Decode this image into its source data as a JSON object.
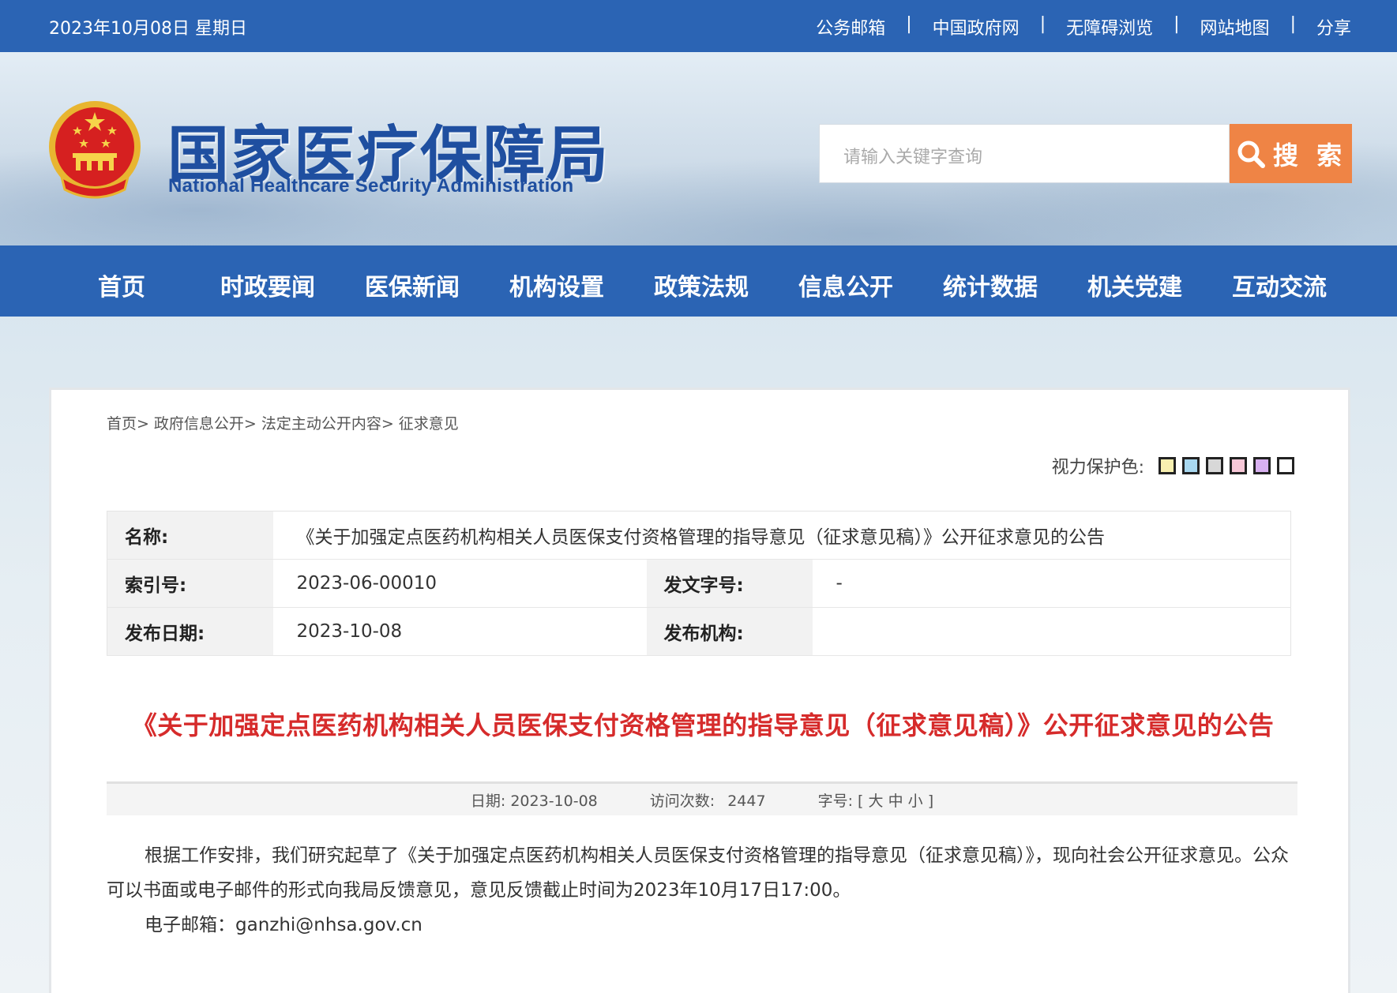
{
  "topbar": {
    "date": "2023年10月08日 星期日",
    "links": [
      "公务邮箱",
      "中国政府网",
      "无障碍浏览",
      "网站地图",
      "分享"
    ],
    "separator": "|"
  },
  "header": {
    "emblem_icon": "national-emblem-icon",
    "logo_cn": "国家医疗保障局",
    "logo_en": "National Healthcare Security Administration",
    "search_placeholder": "请输入关键字查询",
    "search_button": "搜 索"
  },
  "nav": {
    "items": [
      "首页",
      "时政要闻",
      "医保新闻",
      "机构设置",
      "政策法规",
      "信息公开",
      "统计数据",
      "机关党建",
      "互动交流"
    ]
  },
  "breadcrumb": [
    "首页>",
    "政府信息公开>",
    "法定主动公开内容>",
    "征求意见"
  ],
  "vision": {
    "label": "视力保护色:",
    "swatches": [
      "#f8f0b0",
      "#a8d8f0",
      "#d8d8d8",
      "#f8c8d8",
      "#d8b0f0",
      "#ffffff"
    ]
  },
  "info_table": {
    "name_label": "名称:",
    "name_value": "《关于加强定点医药机构相关人员医保支付资格管理的指导意见（征求意见稿）》公开征求意见的公告",
    "index_label": "索引号:",
    "index_value": "2023-06-00010",
    "docno_label": "发文字号:",
    "docno_value": "-",
    "date_label": "发布日期:",
    "date_value": "2023-10-08",
    "org_label": "发布机构:",
    "org_value": ""
  },
  "article": {
    "title": "《关于加强定点医药机构相关人员医保支付资格管理的指导意见（征求意见稿）》公开征求意见的公告",
    "meta_date_label": "日期:",
    "meta_date": "2023-10-08",
    "meta_visits_label": "访问次数:",
    "meta_visits": "2447",
    "meta_font_label": "字号:",
    "meta_font_open": "[",
    "meta_font_large": "大",
    "meta_font_medium": "中",
    "meta_font_small": "小",
    "meta_font_close": "]",
    "para1": "根据工作安排，我们研究起草了《关于加强定点医药机构相关人员医保支付资格管理的指导意见（征求意见稿）》，现向社会公开征求意见。公众可以书面或电子邮件的形式向我局反馈意见，意见反馈截止时间为2023年10月17日17:00。",
    "para2": "电子邮箱：ganzhi@nhsa.gov.cn"
  }
}
